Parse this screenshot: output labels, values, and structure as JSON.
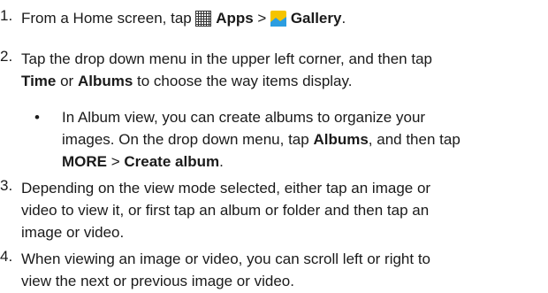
{
  "steps": [
    {
      "number": "1.",
      "before": "From a Home screen, tap ",
      "apps": "Apps",
      "sep": " > ",
      "gallery": "Gallery",
      "end": ".",
      "icons": [
        "apps-grid-icon",
        "gallery-app-icon"
      ]
    },
    {
      "number": "2.",
      "a": "Tap the drop down menu in the upper left corner, and then tap",
      "time": "Time",
      "or": " or ",
      "albums": "Albums",
      "b": " to choose the way items display."
    },
    {
      "bullet": "•",
      "line1": "In Album view, you can create albums to organize your",
      "line2a": "images. On the drop down menu, tap ",
      "albums": "Albums",
      "line2b": ", and then tap",
      "more": "MORE",
      "sep": " > ",
      "create": "Create album",
      "end": "."
    },
    {
      "number": "3.",
      "line1": "Depending on the view mode selected, either tap an image or",
      "line2": "video to view it, or first tap an album or folder and then tap an",
      "line3": "image or video."
    },
    {
      "number": "4.",
      "line1": "When viewing an image or video, you can scroll left or right to",
      "line2": "view the next or previous image or video."
    }
  ],
  "colors": {
    "text": "#1a1a1a",
    "gallery_icon_yellow": "#f5c400",
    "gallery_icon_blue": "#2c9de0"
  }
}
